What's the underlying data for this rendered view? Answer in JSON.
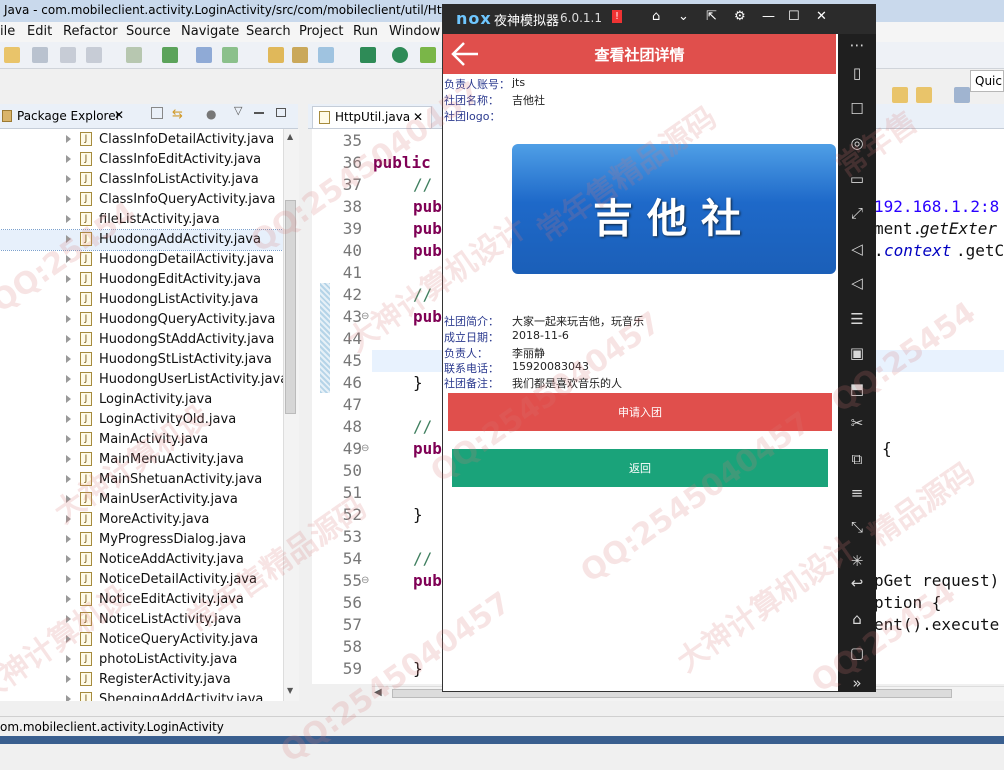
{
  "eclipse": {
    "title": "Java - com.mobileclient.activity.LoginActivity/src/com/mobileclient/util/Htt",
    "menu": [
      "ile",
      "Edit",
      "Refactor",
      "Source",
      "Navigate",
      "Search",
      "Project",
      "Run",
      "Window"
    ],
    "quick_access": "Quick",
    "package_explorer_tab": "Package Explorer",
    "editor_tab": "HttpUtil.java",
    "files": [
      "ClassInfoDetailActivity.java",
      "ClassInfoEditActivity.java",
      "ClassInfoListActivity.java",
      "ClassInfoQueryActivity.java",
      "fileListActivity.java",
      "HuodongAddActivity.java",
      "HuodongDetailActivity.java",
      "HuodongEditActivity.java",
      "HuodongListActivity.java",
      "HuodongQueryActivity.java",
      "HuodongStAddActivity.java",
      "HuodongStListActivity.java",
      "HuodongUserListActivity.java",
      "LoginActivity.java",
      "LoginActivityOld.java",
      "MainActivity.java",
      "MainMenuActivity.java",
      "MainShetuanActivity.java",
      "MainUserActivity.java",
      "MoreActivity.java",
      "MyProgressDialog.java",
      "NoticeAddActivity.java",
      "NoticeDetailActivity.java",
      "NoticeEditActivity.java",
      "NoticeListActivity.java",
      "NoticeQueryActivity.java",
      "photoListActivity.java",
      "RegisterActivity.java",
      "ShenqingAddActivity.java"
    ],
    "line_numbers": [
      "35",
      "36",
      "37",
      "38",
      "39",
      "40",
      "41",
      "42",
      "43",
      "44",
      "45",
      "46",
      "47",
      "48",
      "49",
      "50",
      "51",
      "52",
      "53",
      "54",
      "55",
      "56",
      "57",
      "58",
      "59"
    ],
    "code": {
      "l36": "public",
      "l37": "//",
      "l38": "pub",
      "l39": "pub",
      "l40": "pub",
      "l42": "//",
      "l43": "pub",
      "l46": "}",
      "l48": "//",
      "l49": "pub",
      "l52": "}",
      "l54": "//",
      "l55": "pub",
      "l59": "}",
      "r38": "192.168.1.2:8",
      "r39a": "ment.",
      "r39b": "getExter",
      "r40a": ".",
      "r40b": "context",
      "r40c": ".getC",
      "r49": "{",
      "r55": "pGet request)",
      "r56": "ption {",
      "r57": "ent().execute"
    },
    "status": "om.mobileclient.activity.LoginActivity"
  },
  "nox": {
    "logo": "nox",
    "name": "夜神模拟器",
    "version": "6.0.1.1",
    "badge": "!"
  },
  "app": {
    "title": "查看社团详情",
    "fields": {
      "account_label": "负责人账号：",
      "account_value": "jts",
      "name_label": "社团名称：",
      "name_value": "吉他社",
      "logo_label": "社团logo：",
      "intro_label": "社团简介：",
      "intro_value": "大家一起来玩吉他，玩音乐",
      "date_label": "成立日期：",
      "date_value": "2018-11-6",
      "owner_label": "负责人：",
      "owner_value": "李丽静",
      "phone_label": "联系电话：",
      "phone_value": "15920083043",
      "remark_label": "社团备注：",
      "remark_value": "我们都是喜欢音乐的人"
    },
    "logo_text": "吉他社",
    "join_button": "申请入团",
    "back_button": "返回"
  },
  "watermark": {
    "qq": "QQ:2545040457",
    "qq_short": "QQ:25454",
    "text1": "大神计算机设计",
    "text2": "常年售精品源码",
    "text3": "大神计算机设",
    "text4": "常年售",
    "text5": "精品源码"
  },
  "colors": {
    "app_bar": "#e04f4c",
    "join_button": "#e04f4c",
    "back_button": "#1aa37a",
    "label_text": "#2b3a8f"
  }
}
